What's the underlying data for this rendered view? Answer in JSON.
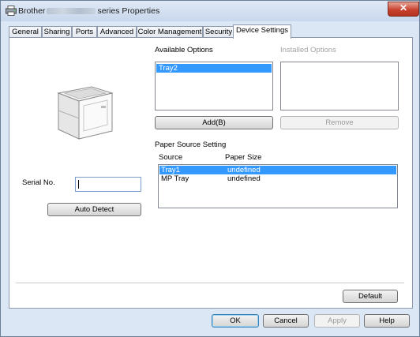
{
  "window": {
    "title_prefix": "Brother",
    "title_suffix": "series Properties",
    "close_glyph": "✕"
  },
  "tabs": [
    {
      "label": "General"
    },
    {
      "label": "Sharing"
    },
    {
      "label": "Ports"
    },
    {
      "label": "Advanced"
    },
    {
      "label": "Color Management"
    },
    {
      "label": "Security"
    },
    {
      "label": "Device Settings",
      "active": true
    }
  ],
  "available_options": {
    "label": "Available Options",
    "items": [
      "Tray2"
    ],
    "selected_index": 0
  },
  "installed_options": {
    "label": "Installed Options",
    "items": []
  },
  "buttons": {
    "add": "Add(B)",
    "remove": "Remove",
    "auto_detect": "Auto Detect",
    "default": "Default",
    "ok": "OK",
    "cancel": "Cancel",
    "apply": "Apply",
    "help": "Help"
  },
  "paper_source": {
    "group_label": "Paper Source Setting",
    "columns": [
      "Source",
      "Paper Size"
    ],
    "rows": [
      {
        "source": "Tray1",
        "size": "undefined"
      },
      {
        "source": "MP Tray",
        "size": "undefined"
      }
    ],
    "selected_index": 0
  },
  "serial": {
    "label": "Serial No.",
    "value": ""
  },
  "colors": {
    "selection": "#3399ff",
    "window_frame": "#dbe7f5",
    "close_button": "#c7432f"
  }
}
